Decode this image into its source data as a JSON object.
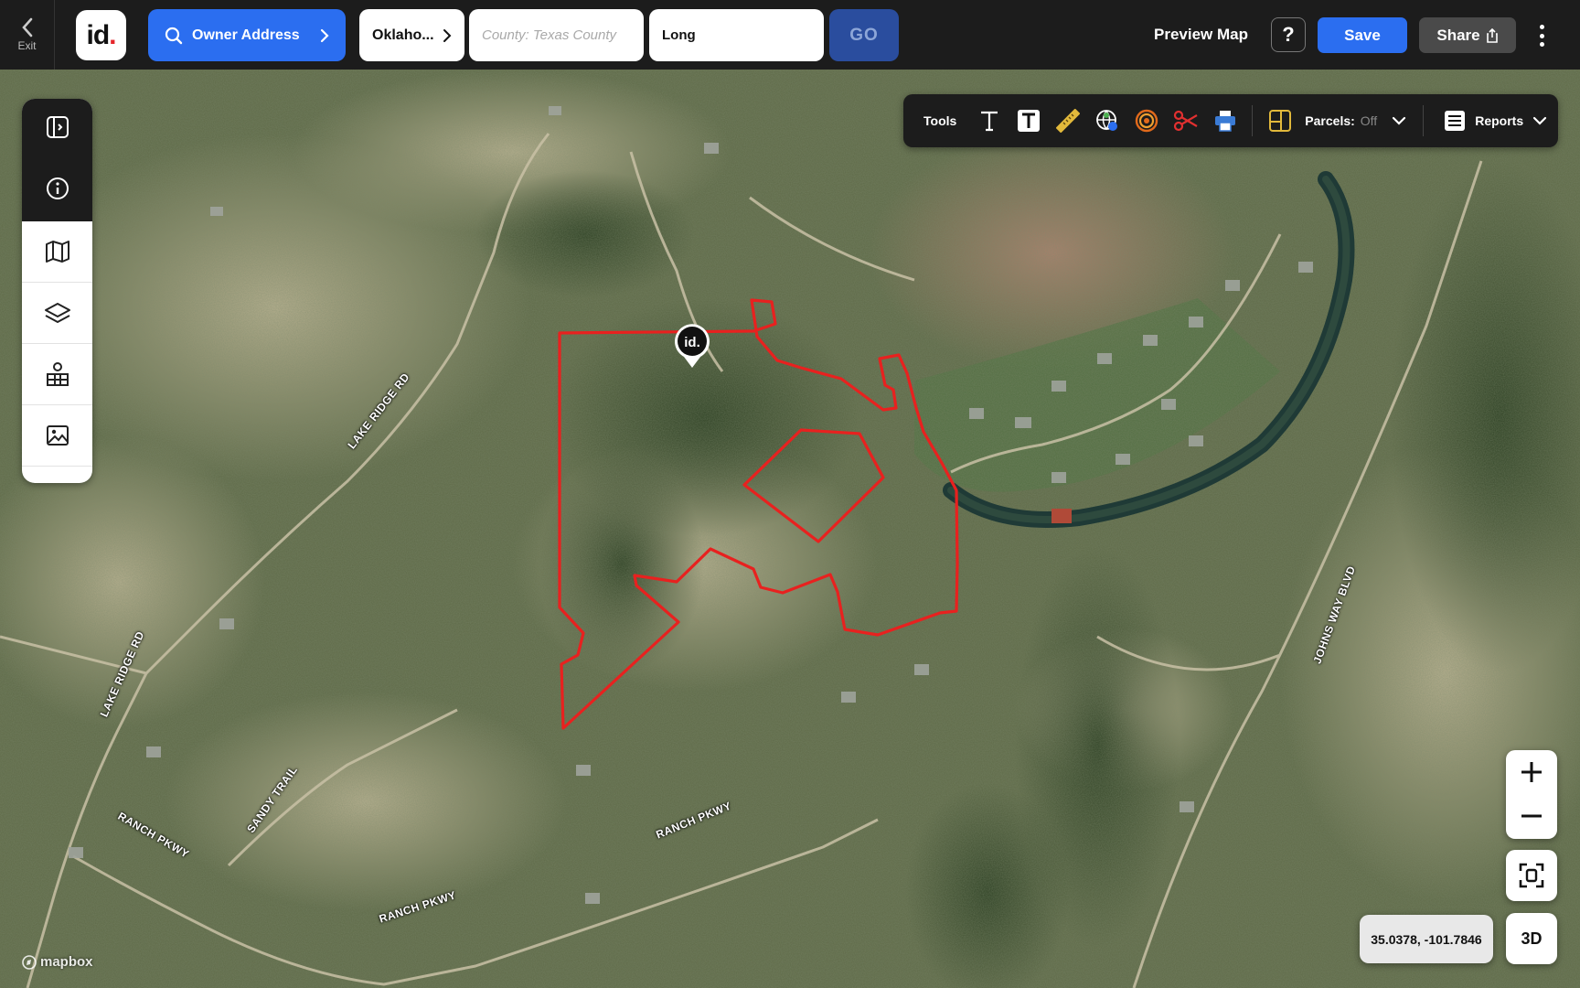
{
  "topbar": {
    "exit_label": "Exit",
    "logo_text": "id",
    "owner_address_label": "Owner Address",
    "state_value": "Oklaho...",
    "county_placeholder": "County: Texas County",
    "longitude_value": "Long",
    "go_label": "GO",
    "preview_map_label": "Preview Map",
    "help_label": "?",
    "save_label": "Save",
    "share_label": "Share"
  },
  "tools": {
    "title": "Tools",
    "items": [
      {
        "name": "text-tool",
        "icon": "text-icon"
      },
      {
        "name": "text-box-tool",
        "icon": "text-box-icon"
      },
      {
        "name": "measure-tool",
        "icon": "ruler-icon"
      },
      {
        "name": "globe-tool",
        "icon": "globe-icon"
      },
      {
        "name": "radius-tool",
        "icon": "radius-icon"
      },
      {
        "name": "cut-tool",
        "icon": "scissors-icon"
      },
      {
        "name": "print-tool",
        "icon": "printer-icon"
      }
    ],
    "parcels_label": "Parcels:",
    "parcels_state": "Off",
    "reports_label": "Reports"
  },
  "sidebar": {
    "items": [
      {
        "name": "sidebar-toggle",
        "icon": "panel-toggle-icon"
      },
      {
        "name": "property-info",
        "icon": "info-icon"
      },
      {
        "name": "map-layers-basemap",
        "icon": "map-icon"
      },
      {
        "name": "layers",
        "icon": "layers-icon"
      },
      {
        "name": "land-features",
        "icon": "buildings-icon"
      },
      {
        "name": "photos",
        "icon": "image-icon"
      }
    ]
  },
  "map": {
    "road_labels": [
      "LAKE RIDGE RD",
      "LAKE RIDGE RD",
      "SANDY TRAIL",
      "RANCH PKWY",
      "RANCH PKWY",
      "RANCH PKWY",
      "JOHNS WAY BLVD"
    ],
    "coordinates": "35.0378, -101.7846",
    "attribution": "mapbox",
    "parcel_outline_color": "#e8211f",
    "pin_label": "id."
  },
  "controls": {
    "zoom_in": "+",
    "zoom_out": "−",
    "view_3d_label": "3D"
  },
  "colors": {
    "accent_blue": "#2b6ef0",
    "go_blue": "#2a4d9e",
    "topbar_bg": "#1c1c1c"
  }
}
